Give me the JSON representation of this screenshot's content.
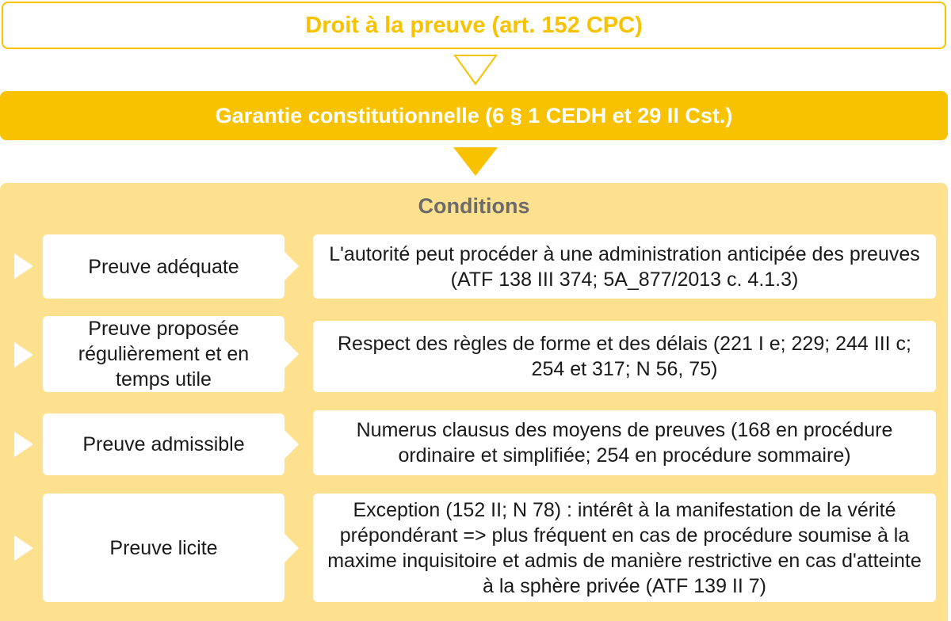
{
  "header": {
    "title": "Droit à la preuve (art. 152 CPC)",
    "guarantee": "Garantie constitutionnelle (6 § 1 CEDH et 29 II Cst.)"
  },
  "conditions": {
    "heading": "Conditions",
    "items": [
      {
        "label": "Preuve adéquate",
        "description": "L'autorité peut procéder à une administration anticipée des preuves (ATF 138 III 374; 5A_877/2013 c. 4.1.3)"
      },
      {
        "label": "Preuve proposée régulièrement et en temps utile",
        "description": "Respect des règles de forme et des délais (221 I e; 229; 244 III c; 254 et 317; N 56, 75)"
      },
      {
        "label": "Preuve admissible",
        "description": "Numerus clausus des moyens de preuves (168 en procédure ordinaire et simplifiée; 254 en procédure sommaire)"
      },
      {
        "label": "Preuve licite",
        "description": "Exception (152 II; N 78) : intérêt à la manifestation de la vérité prépondérant => plus fréquent en cas de procédure soumise à la maxime inquisitoire et admis de manière restrictive en cas d'atteinte à la sphère privée (ATF 139 II 7)"
      }
    ]
  },
  "colors": {
    "accent": "#f9c200",
    "panel": "#fde18f",
    "heading_text": "#6b6b6b"
  }
}
